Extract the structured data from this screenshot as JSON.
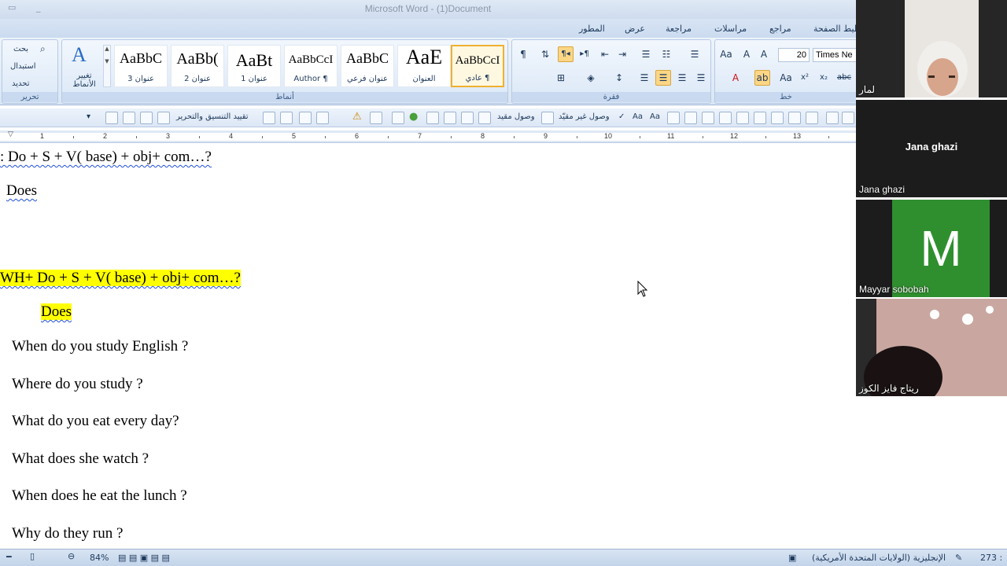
{
  "window": {
    "title": "Microsoft Word - (1)Document"
  },
  "ribbon_tabs": [
    "المطور",
    "عرض",
    "مراجعة",
    "مراسلات",
    "مراجع",
    "تخطيط الصفحة"
  ],
  "ribbon": {
    "styles_group_label": "أنماط",
    "paragraph_group_label": "فقرة",
    "font_group_label": "خط",
    "editing_group_label": "تحرير",
    "editing": {
      "find": "بحث",
      "replace": "استبدال",
      "select": "تحديد"
    },
    "change_styles": "تغيير الأنماط",
    "styles": [
      {
        "sample": "AaBbC",
        "name": "عنوان 3"
      },
      {
        "sample": "AaBb(",
        "name": "عنوان 2"
      },
      {
        "sample": "AaBt",
        "name": "عنوان 1"
      },
      {
        "sample": "AaBbCcI",
        "name": "Author ¶"
      },
      {
        "sample": "AaBbC",
        "name": "عنوان فرعي"
      },
      {
        "sample": "AaE",
        "name": "العنوان"
      },
      {
        "sample": "AaBbCcI",
        "name": "عادي ¶",
        "active": true
      }
    ],
    "font_size": "20",
    "font_name": "Times Ne"
  },
  "toolbar2": {
    "restrict_editing": "تقييد التنسيق والتحرير",
    "restricted_access": "وصول مقيد",
    "unrestricted_access": "وصول غير مقيّد"
  },
  "ruler_numbers": [
    "1",
    "2",
    "3",
    "4",
    "5",
    "6",
    "7",
    "8",
    "9",
    "10",
    "11",
    "12",
    "13"
  ],
  "document": {
    "line1": ": Do  + S + V( base) + obj+ com…?",
    "line2": "Does",
    "line3": "WH+ Do  + S + V( base) + obj+ com…?",
    "line4": "Does",
    "questions": [
      "When do you study English ?",
      "Where do you study ?",
      "What do you eat every day?",
      "What does she watch ?",
      "When does he eat the lunch ?",
      "Why do they run ?"
    ]
  },
  "statusbar": {
    "zoom": "84%",
    "language": "الإنجليزية (الولايات المتحدة الأمريكية)",
    "word_count": "273 :"
  },
  "participants": [
    {
      "name": "لمار"
    },
    {
      "name": "Jana ghazi",
      "display_name": "Jana ghazi"
    },
    {
      "name": "Mayyar sobobah",
      "initial": "M"
    },
    {
      "name": "ريتاج فايز الكوز"
    }
  ]
}
